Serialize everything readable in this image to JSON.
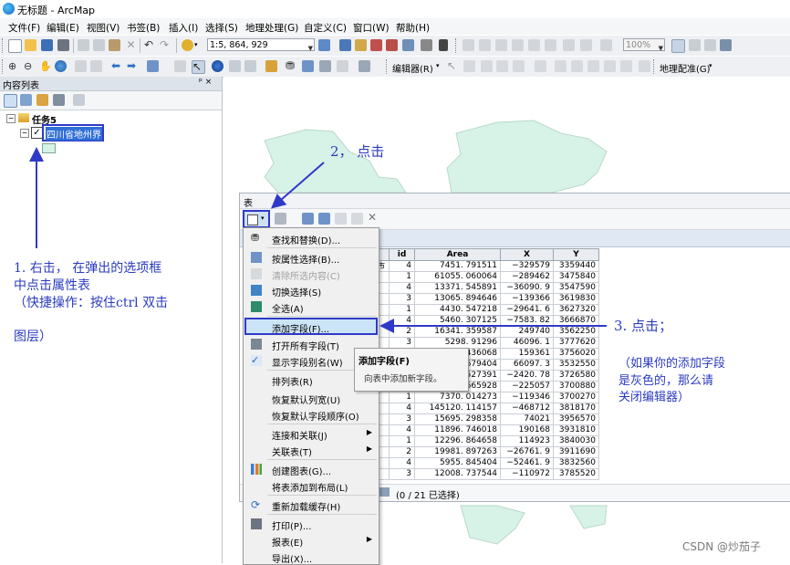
{
  "window": {
    "title": "无标题 - ArcMap"
  },
  "menubar": [
    "文件(F)",
    "编辑(E)",
    "视图(V)",
    "书签(B)",
    "插入(I)",
    "选择(S)",
    "地理处理(G)",
    "自定义(C)",
    "窗口(W)",
    "帮助(H)"
  ],
  "toolbar1": {
    "scale": "1:5, 864, 929",
    "zoom": "100%"
  },
  "toolbar2": {
    "editor_label": "编辑器(R)",
    "georef_label": "地理配准(G)"
  },
  "toc": {
    "header": "内容列表",
    "pin": "ᵖ ×",
    "dataframe": "任务5",
    "layer": "四川省地州界"
  },
  "table_window": {
    "title": "表",
    "status": "(0 / 21 已选择)",
    "columns": [
      "id",
      "Area",
      "X",
      "Y"
    ],
    "hidden_fragment": "市",
    "rows": [
      {
        "id": "4",
        "area": "7451. 791511",
        "x": "−329579",
        "y": "3359440"
      },
      {
        "id": "1",
        "area": "61055. 060064",
        "x": "−289462",
        "y": "3475840"
      },
      {
        "id": "4",
        "area": "13371. 545891",
        "x": "−36090. 9",
        "y": "3547590"
      },
      {
        "id": "3",
        "area": "13065. 894646",
        "x": "−139366",
        "y": "3619830"
      },
      {
        "id": "1",
        "area": "4430. 547218",
        "x": "−29641. 6",
        "y": "3627320"
      },
      {
        "id": "4",
        "area": "5460. 307125",
        "x": "−7583. 82",
        "y": "3666870"
      },
      {
        "id": "2",
        "area": "16341. 359587",
        "x": "249740",
        "y": "3562250"
      },
      {
        "id": "3",
        "area": "5298. 91296",
        "x": "46096. 1",
        "y": "3777620"
      },
      {
        "id": "",
        "area": "3284. 436068",
        "x": "159361",
        "y": "3756020"
      },
      {
        "id": "",
        "area": "2171. 679404",
        "x": "66097. 3",
        "y": "3532550"
      },
      {
        "id": "",
        "area": "7888. 527391",
        "x": "−2420. 78",
        "y": "3726580"
      },
      {
        "id": "",
        "area": "8137. 665928",
        "x": "−225057",
        "y": "3700880"
      },
      {
        "id": "1",
        "area": "7370. 014273",
        "x": "−119346",
        "y": "3700270"
      },
      {
        "id": "4",
        "area": "145120. 114157",
        "x": "−468712",
        "y": "3818170"
      },
      {
        "id": "3",
        "area": "15695. 298358",
        "x": "74021",
        "y": "3956570"
      },
      {
        "id": "4",
        "area": "11896. 746018",
        "x": "190168",
        "y": "3931810"
      },
      {
        "id": "1",
        "area": "12296. 864658",
        "x": "114923",
        "y": "3840030"
      },
      {
        "id": "2",
        "area": "19981. 897263",
        "x": "−26761. 9",
        "y": "3911690"
      },
      {
        "id": "4",
        "area": "5955. 845404",
        "x": "−52461. 9",
        "y": "3832560"
      },
      {
        "id": "3",
        "area": "12008. 737544",
        "x": "−110972",
        "y": "3785520"
      }
    ]
  },
  "context_menu": {
    "items": [
      {
        "label": "查找和替换(D)...",
        "icon": "binoculars-icon"
      },
      {
        "label": "按属性选择(B)...",
        "icon": "select-by-attributes-icon"
      },
      {
        "label": "清除所选内容(C)",
        "icon": "clear-selection-icon",
        "disabled": true
      },
      {
        "label": "切换选择(S)",
        "icon": "switch-selection-icon"
      },
      {
        "label": "全选(A)",
        "icon": "select-all-icon"
      },
      {
        "label": "添加字段(F)...",
        "icon": "",
        "highlighted": true
      },
      {
        "label": "打开所有字段(T)",
        "icon": "fields-icon"
      },
      {
        "label": "显示字段别名(W)",
        "icon": "checkmark-icon"
      },
      {
        "label": "排列表(R)",
        "icon": "",
        "submenu": true
      },
      {
        "label": "恢复默认列宽(U)",
        "icon": ""
      },
      {
        "label": "恢复默认字段顺序(O)",
        "icon": ""
      },
      {
        "label": "连接和关联(J)",
        "icon": "",
        "submenu": true
      },
      {
        "label": "关联表(T)",
        "icon": "",
        "submenu": true
      },
      {
        "label": "创建图表(G)...",
        "icon": "chart-icon"
      },
      {
        "label": "将表添加到布局(L)",
        "icon": ""
      },
      {
        "label": "重新加载缓存(H)",
        "icon": "reload-icon"
      },
      {
        "label": "打印(P)...",
        "icon": "print-icon"
      },
      {
        "label": "报表(E)",
        "icon": "",
        "submenu": true
      },
      {
        "label": "导出(X)...",
        "icon": ""
      }
    ]
  },
  "tooltip": {
    "title": "添加字段(F)",
    "body": "向表中添加新字段。"
  },
  "annotations": {
    "step1_line1": "1. 右击， 在弹出的选项框",
    "step1_line2": "中点击属性表",
    "step1_line3": "（快捷操作：按住ctrl 双击",
    "step1_line4": "图层）",
    "step2": "2， 点击",
    "step3": "3. 点击；",
    "note_line1": "（如果你的添加字段",
    "note_line2": "是灰色的，那么请",
    "note_line3": "关闭编辑器）"
  },
  "watermark": "CSDN @炒茄子",
  "colors": {
    "annotation": "#2b3bbf",
    "map_fill": "#d7f2e6",
    "menu_highlight": "#cce4f7"
  }
}
